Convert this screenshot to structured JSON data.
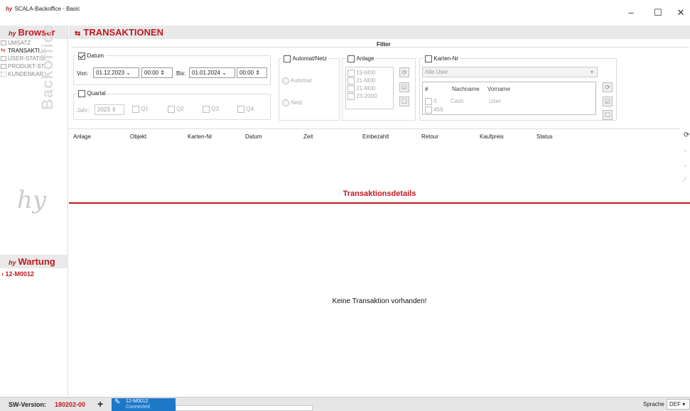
{
  "window": {
    "title": "SCALA-Backoffice - Basic",
    "logo": "hy",
    "minimize": "–",
    "maximize": "☐",
    "close": "✕"
  },
  "sidebar": {
    "browser_label": "Browser",
    "items": [
      {
        "label": "UMSATZ",
        "icon": "chart-icon"
      },
      {
        "label": "TRANSAKTI...",
        "icon": "transaction-arrows-icon"
      },
      {
        "label": "USER-STATIS...",
        "icon": "chart-icon"
      },
      {
        "label": "PRODUKT-ST...",
        "icon": "chart-icon"
      },
      {
        "label": "KUNDENKAR...",
        "icon": "people-icon"
      }
    ],
    "watermark": "Backoffice",
    "wartung_label": "Wartung",
    "wartung_item": "12-M0012"
  },
  "main": {
    "title": "TRANSAKTIONEN"
  },
  "filter": {
    "title": "Filter",
    "datum": {
      "label": "Datum",
      "checked": true,
      "von_label": "Von:",
      "von_date": "01.12.2023",
      "von_time": "00:00",
      "bis_label": "Bis:",
      "bis_date": "01.01.2024",
      "bis_time": "00:00"
    },
    "quartal": {
      "label": "Quartal",
      "jahr_label": "Jahr:",
      "jahr": "2023",
      "q1": "Q1",
      "q2": "Q2",
      "q3": "Q3",
      "q4": "Q4"
    },
    "automat_netz": {
      "label": "Automat/Netz",
      "automat": "Automat",
      "netz": "Netz"
    },
    "anlage": {
      "label": "Anlage",
      "items": [
        "19-M00",
        "21-M00",
        "21-M00",
        "23-2000"
      ]
    },
    "karten": {
      "label": "Karten-Nr",
      "user_select": "Alle User",
      "cols": [
        "#",
        "Nachname",
        "Vorname"
      ],
      "rows": [
        [
          "0",
          "Cash",
          "User"
        ],
        [
          "456",
          "",
          ""
        ]
      ]
    }
  },
  "table": {
    "columns": [
      "Anlage",
      "Objekt",
      "Karten-Nr",
      "Datum",
      "Zeit",
      "Einbezahlt",
      "Retour",
      "Kaufpreis",
      "Status"
    ]
  },
  "details": {
    "title": "Transaktionsdetails",
    "empty": "Keine Transaktion vorhanden!"
  },
  "status": {
    "sw_label": "SW-Version:",
    "sw_value": "180202-00",
    "conn_name": "12-M0012",
    "conn_state": "Connected",
    "sprache_label": "Sprache",
    "sprache_value": "DEF"
  },
  "colors": {
    "accent": "#c0181f",
    "connected": "#1e78c8"
  }
}
